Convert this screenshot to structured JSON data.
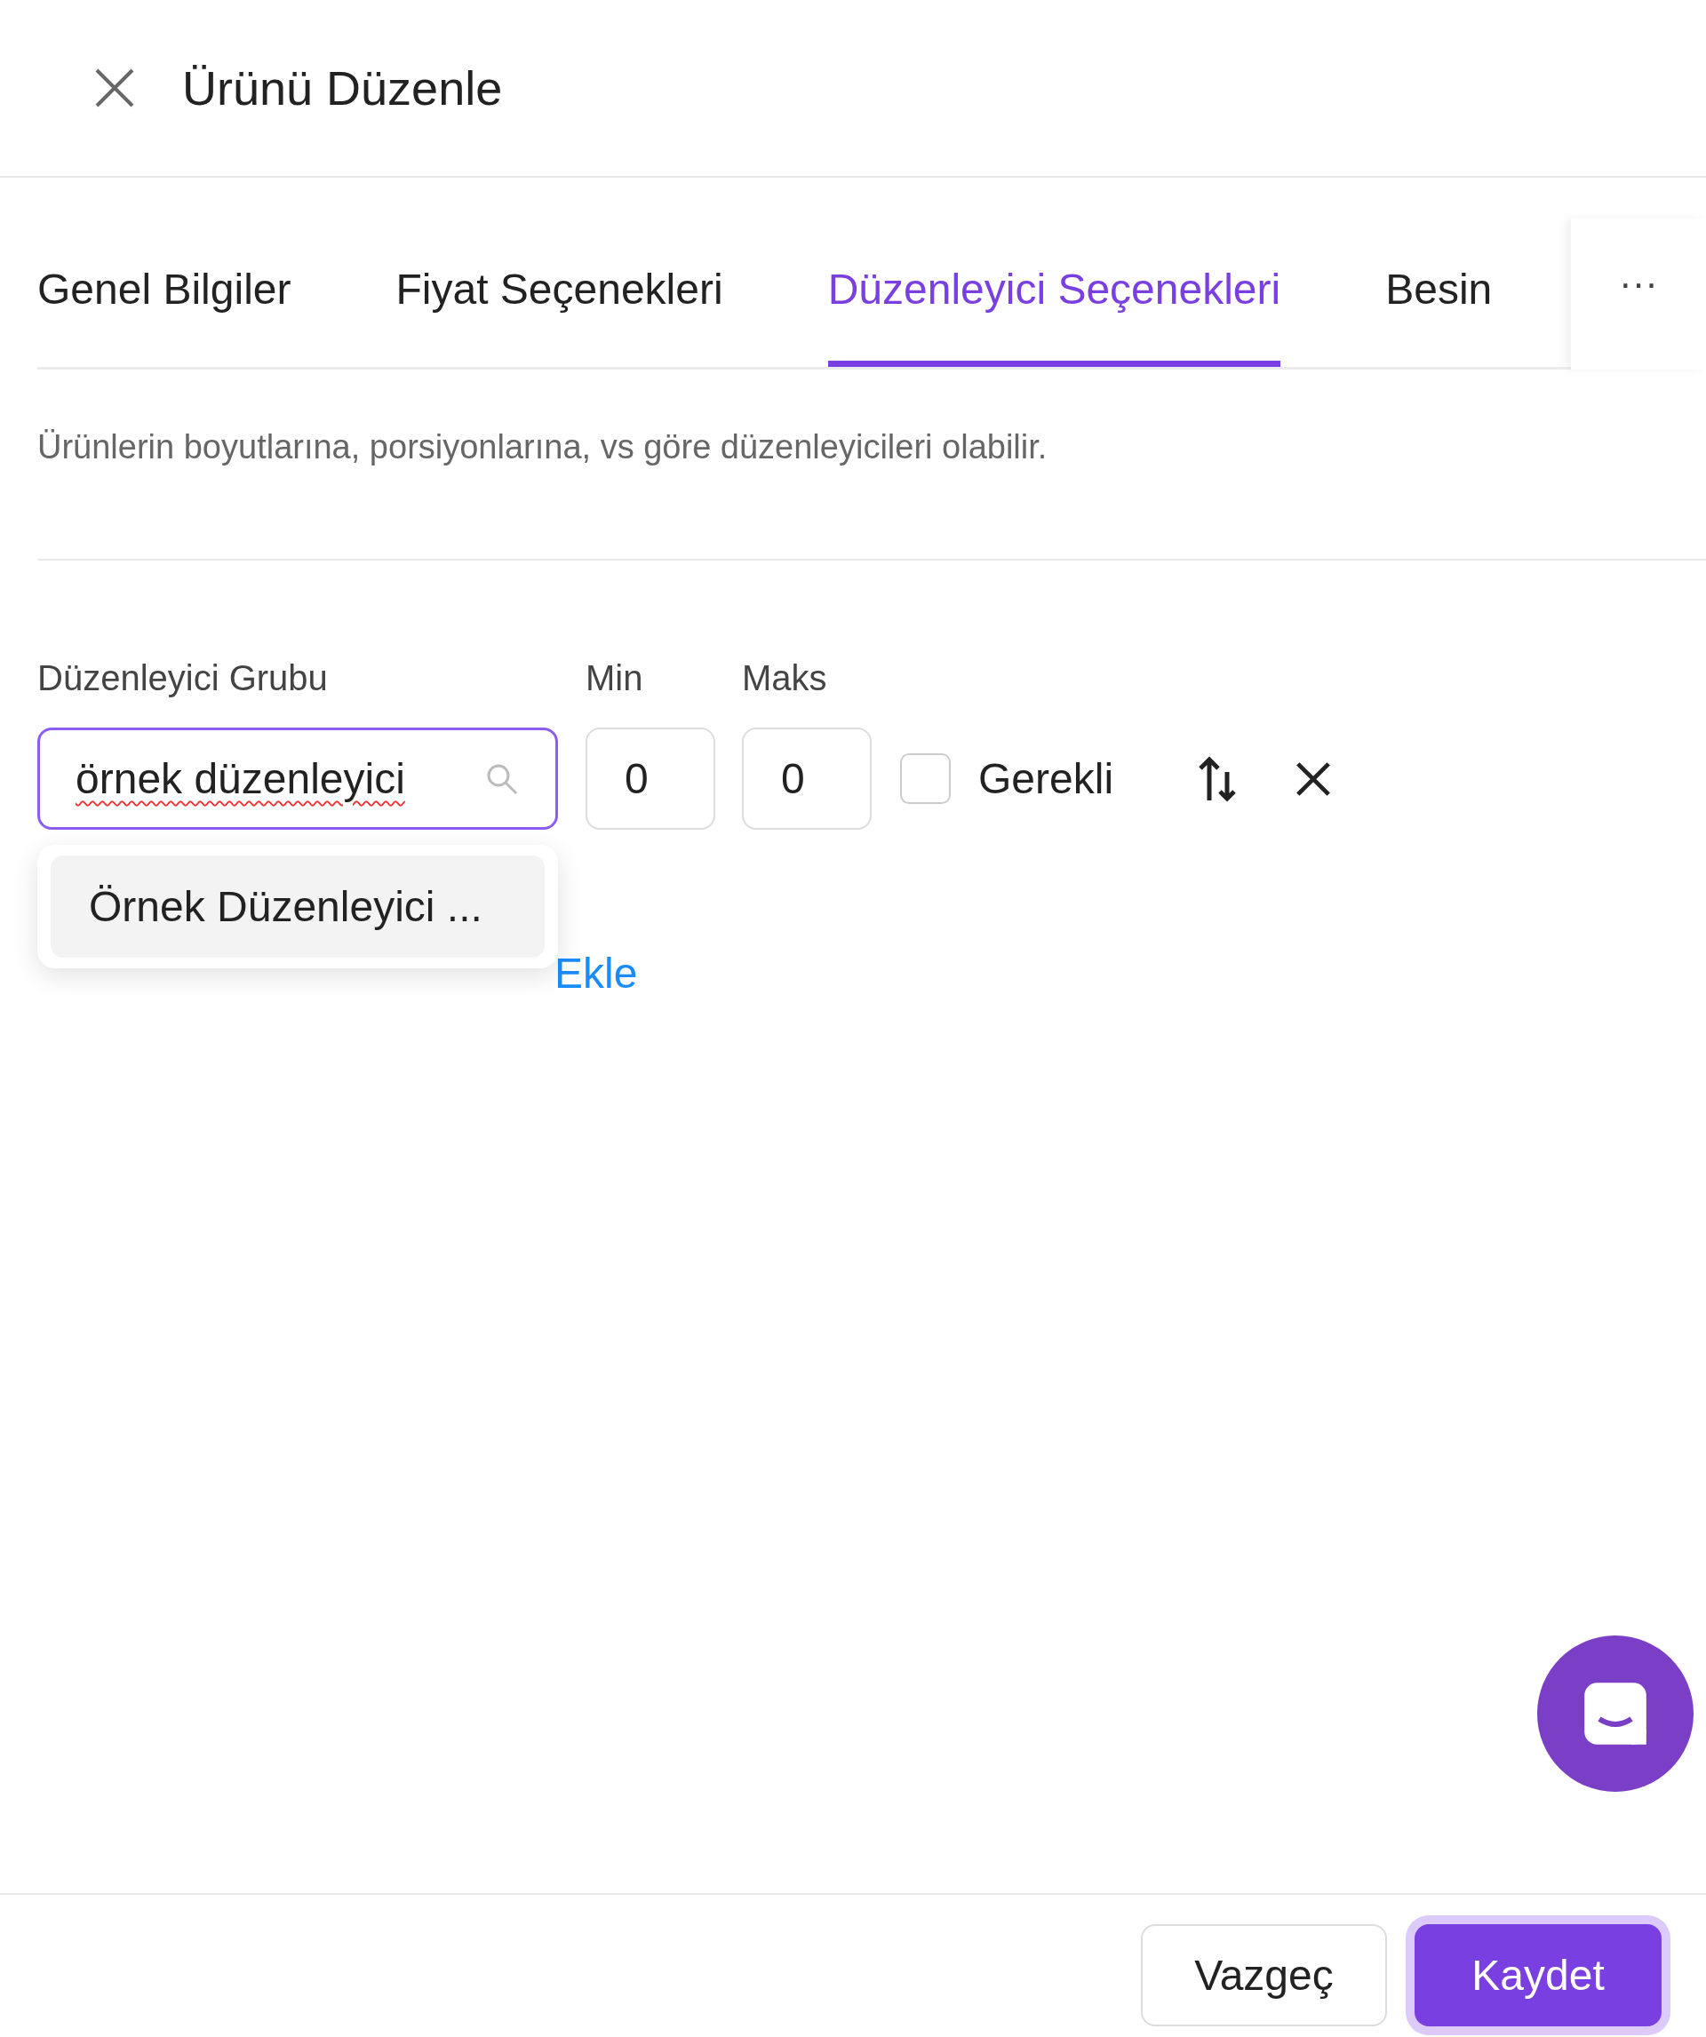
{
  "header": {
    "title": "Ürünü Düzenle"
  },
  "tabs": [
    {
      "label": "Genel Bilgiler",
      "selected": false
    },
    {
      "label": "Fiyat Seçenekleri",
      "selected": false
    },
    {
      "label": "Düzenleyici Seçenekleri",
      "selected": true
    },
    {
      "label": "Besin",
      "selected": false
    }
  ],
  "tabs_more": "···",
  "description": "Ürünlerin boyutlarına, porsiyonlarına, vs göre düzenleyicileri olabilir.",
  "modifier_row": {
    "group_label": "Düzenleyici Grubu",
    "min_label": "Min",
    "max_label": "Maks",
    "group_value": "örnek düzenleyici",
    "min_value": "0",
    "max_value": "0",
    "required": {
      "label": "Gerekli",
      "checked": false
    }
  },
  "dropdown": {
    "items": [
      {
        "label": "Örnek Düzenleyici ...",
        "selected": true
      }
    ]
  },
  "add_link": "Ekle",
  "footer": {
    "cancel": "Vazgeç",
    "save": "Kaydet"
  }
}
